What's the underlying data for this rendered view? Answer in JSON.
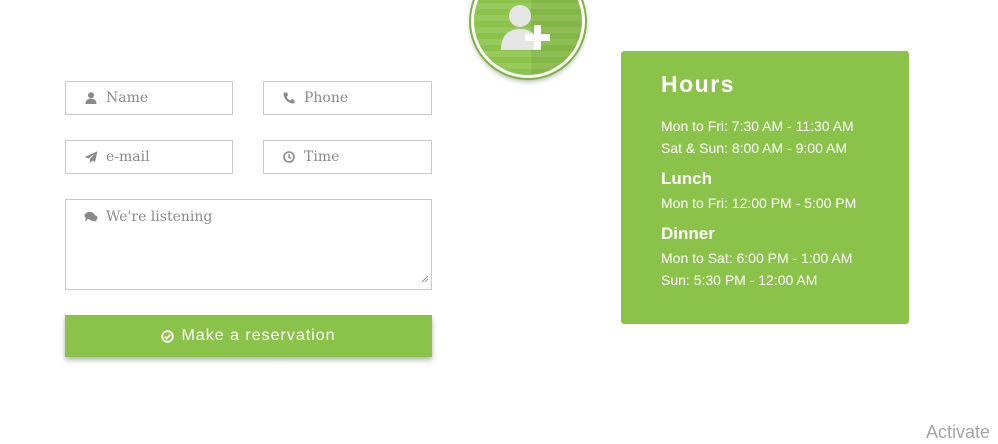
{
  "badge": {
    "icon": "add-user-icon"
  },
  "form": {
    "name_placeholder": "Name",
    "phone_placeholder": "Phone",
    "email_placeholder": "e-mail",
    "time_placeholder": "Time",
    "message_placeholder": "We're listening",
    "submit_label": "Make a reservation"
  },
  "hours": {
    "title": "Hours",
    "general": [
      "Mon to Fri: 7:30 AM - 11:30 AM",
      "Sat & Sun: 8:00 AM - 9:00 AM"
    ],
    "lunch_title": "Lunch",
    "lunch": [
      "Mon to Fri: 12:00 PM - 5:00 PM"
    ],
    "dinner_title": "Dinner",
    "dinner": [
      "Mon to Sat: 6:00 PM - 1:00 AM",
      "Sun: 5:30 PM - 12:00 AM"
    ]
  },
  "watermark": "Activate",
  "colors": {
    "accent": "#8bc34a",
    "border": "#c9c9c9",
    "placeholder": "#8a8a8a"
  }
}
